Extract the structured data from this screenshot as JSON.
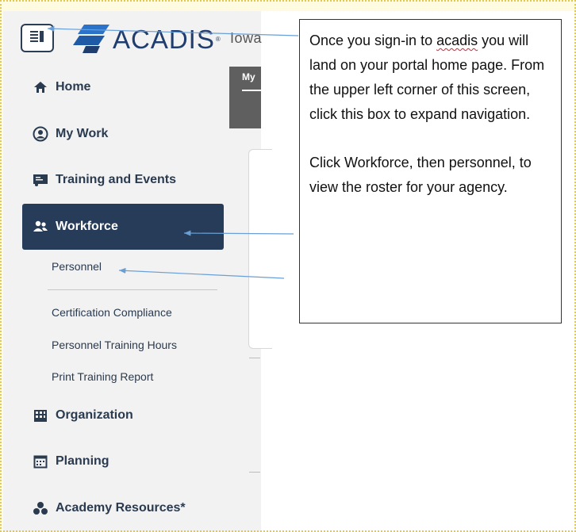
{
  "app": {
    "logo_text": "ACADIS",
    "logo_reg": "®",
    "site_label": "Iowa"
  },
  "icons": {
    "menu": "menu-toggle-icon",
    "home": "home-icon",
    "my_work": "user-circle-icon",
    "training": "presentation-icon",
    "workforce": "users-icon",
    "organization": "building-icon",
    "planning": "calendar-icon",
    "academy": "cubes-icon"
  },
  "sidebar": {
    "items": [
      {
        "label": "Home"
      },
      {
        "label": "My Work"
      },
      {
        "label": "Training and Events"
      },
      {
        "label": "Workforce",
        "active": true
      },
      {
        "label": "Organization"
      },
      {
        "label": "Planning"
      },
      {
        "label": "Academy Resources*"
      }
    ],
    "workforce_sub": [
      {
        "label": "Personnel"
      },
      {
        "label": "Certification Compliance"
      },
      {
        "label": "Personnel Training Hours"
      },
      {
        "label": "Print Training Report"
      }
    ]
  },
  "main": {
    "tab_label": "My"
  },
  "callout": {
    "p1_a": "Once you sign-in to ",
    "p1_word": "acadis",
    "p1_b": " you will land on your portal home page. From the upper left corner of this screen, click this box to expand navigation.",
    "p2": "Click Workforce, then personnel, to view the roster for your agency."
  },
  "colors": {
    "nav_active_bg": "#263c59",
    "brand_blue": "#1f3e6f",
    "arrow": "#6a9fd6",
    "page_bg": "#fffbe0"
  }
}
